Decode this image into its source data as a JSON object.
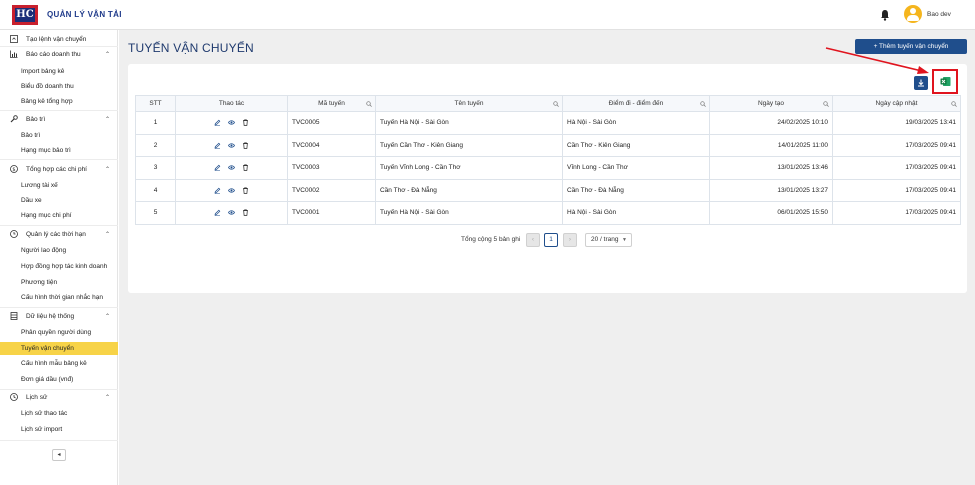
{
  "app": {
    "title": "QUẢN LÝ VẬN TẢI",
    "logo_text": "HC"
  },
  "header": {
    "user_name": "Bao dev"
  },
  "sidebar": {
    "top_item": "Tạo lệnh vận chuyển",
    "groups": [
      {
        "label": "Báo cáo doanh thu",
        "items": [
          "Import bảng kê",
          "Biểu đồ doanh thu",
          "Bảng kê tổng hợp"
        ]
      },
      {
        "label": "Bảo trì",
        "items": [
          "Bảo trì",
          "Hạng mục bảo trì"
        ]
      },
      {
        "label": "Tổng hợp các chi phí",
        "items": [
          "Lương tài xế",
          "Dầu xe",
          "Hạng mục chi phí"
        ]
      },
      {
        "label": "Quản lý các thời hạn",
        "items": [
          "Người lao động",
          "Hợp đồng hợp tác kinh doanh",
          "Phương tiện",
          "Cấu hình thời gian nhắc hạn"
        ]
      },
      {
        "label": "Dữ liệu hệ thống",
        "items": [
          "Phân quyền người dùng",
          "Tuyến vận chuyển",
          "Cấu hình mẫu bảng kê",
          "Đơn giá dầu (vnđ)"
        ]
      },
      {
        "label": "Lịch sử",
        "items": [
          "Lịch sử thao tác",
          "Lịch sử import"
        ]
      }
    ],
    "active_item": "Tuyến vận chuyển"
  },
  "main": {
    "page_title": "TUYẾN VẬN CHUYỂN",
    "add_button": "+ Thêm tuyến vận chuyển",
    "table": {
      "headers": [
        "STT",
        "Thao tác",
        "Mã tuyến",
        "Tên tuyến",
        "Điểm đi - điểm đến",
        "Ngày tạo",
        "Ngày cập nhật"
      ],
      "rows": [
        {
          "stt": "1",
          "code": "TVC0005",
          "name": "Tuyến Hà Nội - Sài Gòn",
          "route": "Hà Nội - Sài Gòn",
          "created": "24/02/2025 10:10",
          "updated": "19/03/2025 13:41"
        },
        {
          "stt": "2",
          "code": "TVC0004",
          "name": "Tuyến Cần Thơ - Kiên Giang",
          "route": "Cần Thơ - Kiên Giang",
          "created": "14/01/2025 11:00",
          "updated": "17/03/2025 09:41"
        },
        {
          "stt": "3",
          "code": "TVC0003",
          "name": "Tuyến Vĩnh Long - Cần Thơ",
          "route": "Vĩnh Long - Cần Thơ",
          "created": "13/01/2025 13:46",
          "updated": "17/03/2025 09:41"
        },
        {
          "stt": "4",
          "code": "TVC0002",
          "name": "Cần Thơ - Đà Nẵng",
          "route": "Cần Thơ - Đà Nẵng",
          "created": "13/01/2025 13:27",
          "updated": "17/03/2025 09:41"
        },
        {
          "stt": "5",
          "code": "TVC0001",
          "name": "Tuyến Hà Nội - Sài Gòn",
          "route": "Hà Nội - Sài Gòn",
          "created": "06/01/2025 15:50",
          "updated": "17/03/2025 09:41"
        }
      ]
    },
    "pagination": {
      "total_text": "Tổng cộng 5 bản ghi",
      "current_page": "1",
      "page_size": "20 / trang"
    }
  },
  "colors": {
    "accent": "#1f4e8c",
    "active_bg": "#f7d348",
    "highlight": "#e0141e",
    "excel": "#1d7a45"
  },
  "icons": [
    "bell-icon",
    "user-avatar-icon",
    "edit-icon",
    "view-icon",
    "delete-icon",
    "download-icon",
    "excel-icon",
    "search-icon"
  ]
}
